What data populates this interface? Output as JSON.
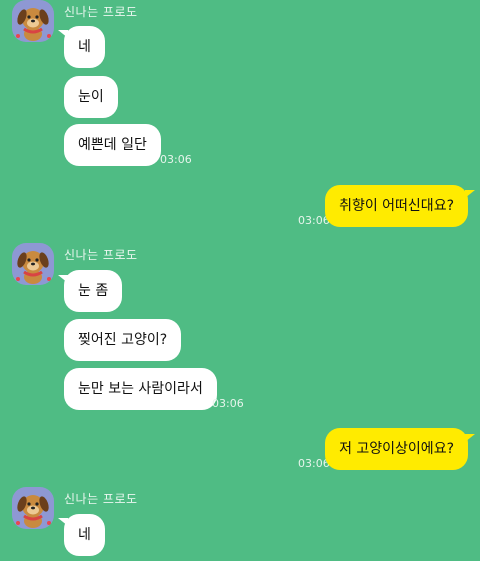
{
  "colors": {
    "background": "#4fbc84",
    "incoming_bubble": "#ffffff",
    "outgoing_bubble": "#ffeb00",
    "avatar": "#8e98d3"
  },
  "groups": [
    {
      "sender": "신나는 프로도",
      "messages": [
        "네",
        "눈이",
        "예쁜데 일단"
      ],
      "time": "03:06"
    },
    {
      "outgoing": "취향이 어떠신대요?",
      "time": "03:06"
    },
    {
      "sender": "신나는 프로도",
      "messages": [
        "눈 좀",
        "찢어진 고양이?",
        "눈만 보는 사람이라서"
      ],
      "time": "03:06"
    },
    {
      "outgoing": "저 고양이상이에요?",
      "time": "03:06"
    },
    {
      "sender": "신나는 프로도",
      "messages": [
        "네"
      ]
    }
  ]
}
